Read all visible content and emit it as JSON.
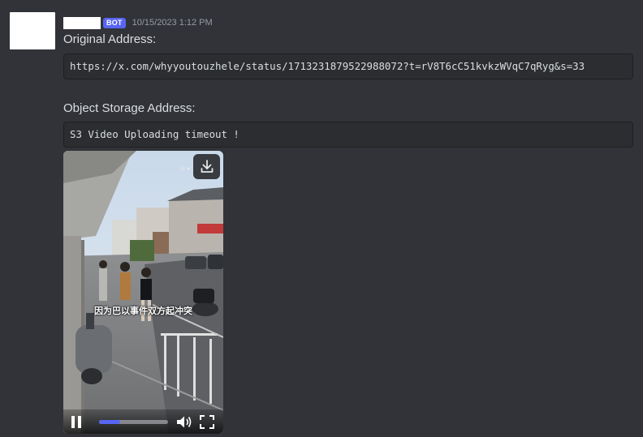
{
  "message": {
    "bot_tag": "BOT",
    "timestamp": "10/15/2023 1:12 PM",
    "original_label": "Original Address:",
    "original_url": "https://x.com/whyyoutouzhele/status/1713231879522988072?t=rV8T6cC51kvkzWVqC7qRyg&s=33",
    "storage_label": "Object Storage Address:",
    "storage_value": "S3 Video Uploading timeout !"
  },
  "video": {
    "subtitle": "因为巴以事件双方起冲突",
    "progress": 0.3,
    "icons": [
      "download-icon",
      "pause-icon",
      "volume-icon",
      "fullscreen-icon"
    ]
  },
  "colors": {
    "background": "#313338",
    "codeblock": "#2b2d31",
    "bot_tag": "#5865f2",
    "timestamp": "#949ba4"
  }
}
